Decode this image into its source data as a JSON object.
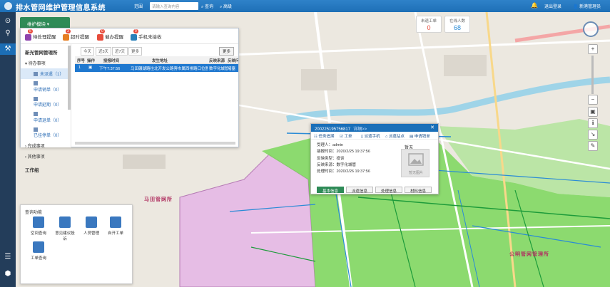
{
  "header": {
    "title": "排水管网维护管理信息系统",
    "scope": "范围",
    "search_placeholder": "请输入查询内容",
    "query_btn": "查询",
    "advanced_btn": "高级",
    "logout": "退出登录",
    "user": "新港管理员"
  },
  "module": {
    "tab_label": "维护模块",
    "reminders": [
      {
        "label": "待处理提醒",
        "count": "5",
        "color": "#8e44ad"
      },
      {
        "label": "超时提醒",
        "count": "3",
        "color": "#e67e22"
      },
      {
        "label": "催办提醒",
        "count": "0",
        "color": "#e74c3c"
      },
      {
        "label": "手机未接收",
        "count": "0",
        "color": "#2980b9"
      }
    ],
    "tree": {
      "title": "新光管网管理所",
      "group_pending": "待办事项",
      "items": [
        "未派遣（1）",
        "申请销单（0）",
        "申请延期（0）",
        "申请退单（0）",
        "已挂停单（0）"
      ],
      "group_done": "完成事项",
      "group_other": "其他事项",
      "workflow": "工作组"
    },
    "filters": [
      "今天",
      "近3天",
      "近7天",
      "更多"
    ],
    "more_btn": "更多",
    "columns": [
      "序号",
      "操作",
      "接报时间",
      "发生地址",
      "反映来源",
      "反映问"
    ],
    "row": {
      "index": "1",
      "time": "下午7:37:56",
      "address": "马田碾湖路往北开发公路旁市属西排路口位置",
      "source": "数字化城管",
      "issue": "堵塞"
    }
  },
  "stats": {
    "unfinished_label": "未退工单",
    "unfinished_value": "0",
    "online_label": "在线人数",
    "online_value": "68"
  },
  "popup": {
    "id": "200225195756817",
    "details_link": "详细>>",
    "buttons": [
      "任务追溯",
      "工单",
      "派遣手机",
      "派遣站点",
      "申请销单"
    ],
    "fields": [
      "受理人：admin",
      "接报时间：2020/2/25 19:37:56",
      "反映类型：投诉",
      "反映来源：数字化城管",
      "处理时间：2020/2/26 19:37:56"
    ],
    "photo_label": "暂无",
    "photo_text": "暂无图片",
    "tabs": [
      "基本信息",
      "派遣信息",
      "处理信息",
      "材料信息"
    ]
  },
  "query_panel": {
    "title": "查询功能",
    "items": [
      "空间查询",
      "意见建议投诉",
      "人员管理",
      "自开工单",
      "工单查询"
    ]
  },
  "map_labels": {
    "region1": "马田管网所",
    "region2": "公明管网管理所"
  },
  "colors": {
    "topbar": "#1e6fb6",
    "module_green": "#2e8b57",
    "selected_row": "#1f78cf",
    "green_region": "#7bd75a",
    "pink_region": "#e6b9e6"
  }
}
